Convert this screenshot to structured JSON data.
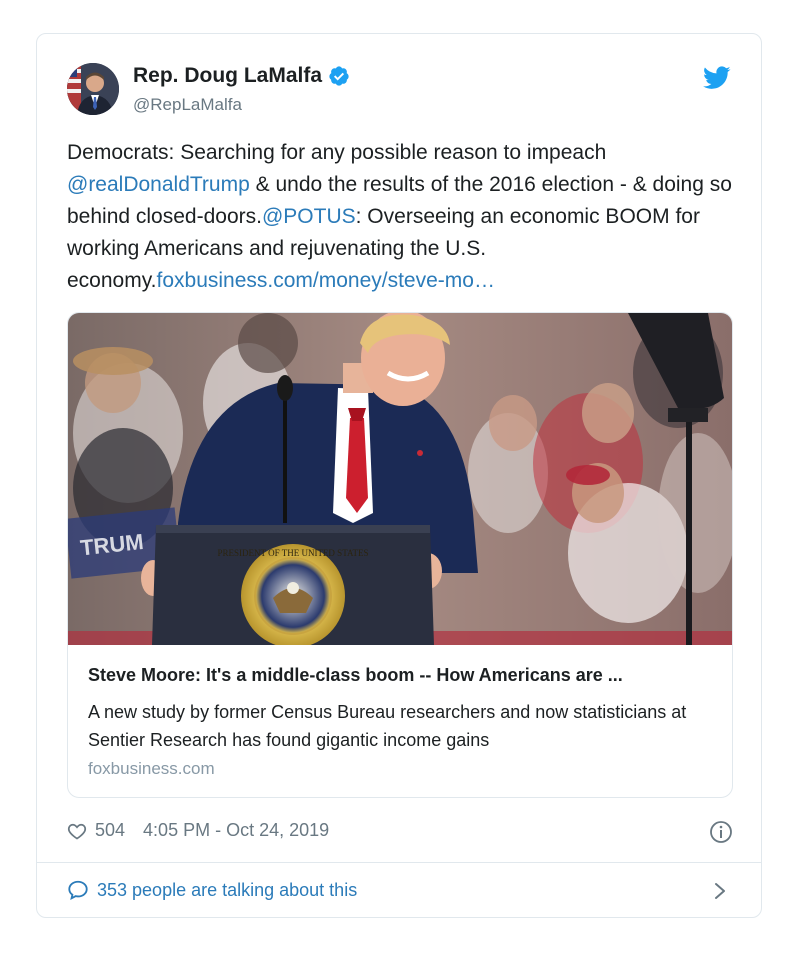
{
  "author": {
    "name": "Rep. Doug LaMalfa",
    "handle": "@RepLaMalfa"
  },
  "tweet": {
    "part1": "Democrats: Searching for any possible reason to impeach ",
    "mention1": "@realDonaldTrump",
    "part2": " & undo the results of the 2016 election - & doing so behind closed-doors.",
    "mention2": "@POTUS",
    "part3": ": Overseeing an economic BOOM for working Americans and rejuvenating the U.S. economy.",
    "link": "foxbusiness.com/money/steve-mo…"
  },
  "link_card": {
    "title": "Steve Moore: It's a middle-class boom -- How Americans are ...",
    "description": "A new study by former Census Bureau researchers and now statisticians at Sentier Research has found gigantic income gains",
    "domain": "foxbusiness.com",
    "seal_text": "PRESIDENT OF THE UNITED STATES"
  },
  "meta": {
    "likes": "504",
    "timestamp": "4:05 PM - Oct 24, 2019"
  },
  "footer": {
    "talking": "353 people are talking about this"
  },
  "icons": {
    "verified": "verified-badge-icon",
    "bird": "twitter-bird-icon",
    "heart": "heart-icon",
    "info": "info-icon",
    "reply": "speech-bubble-icon",
    "chevron": "chevron-right-icon"
  },
  "colors": {
    "link": "#2b7bb9",
    "twitter_blue": "#1da1f2",
    "muted": "#697882",
    "border": "#e1e8ed"
  }
}
